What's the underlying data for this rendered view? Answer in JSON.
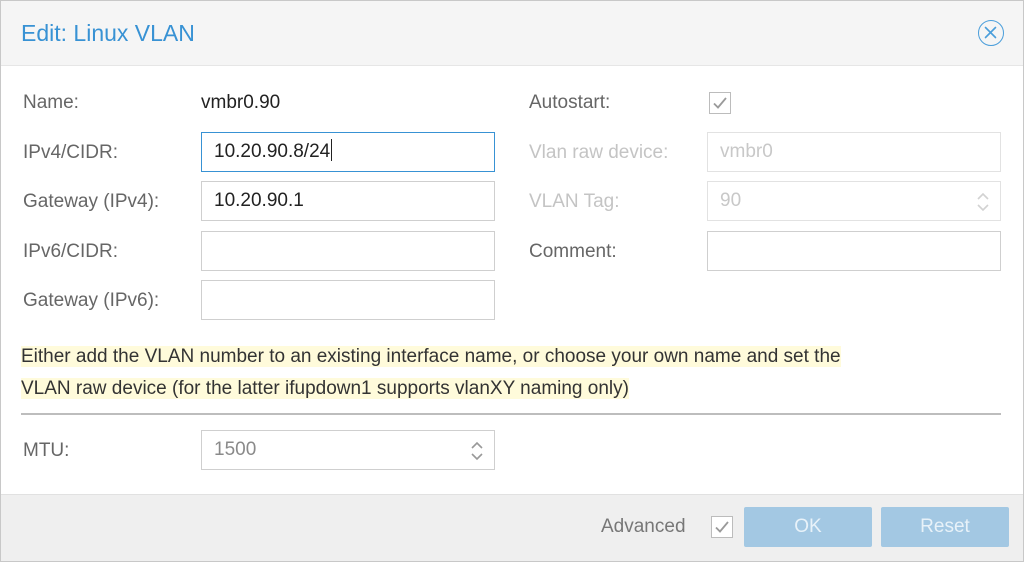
{
  "dialog": {
    "title": "Edit: Linux VLAN"
  },
  "form": {
    "name_label": "Name:",
    "name_value": "vmbr0.90",
    "ipv4_label": "IPv4/CIDR:",
    "ipv4_value": "10.20.90.8/24",
    "gateway4_label": "Gateway (IPv4):",
    "gateway4_value": "10.20.90.1",
    "ipv6_label": "IPv6/CIDR:",
    "ipv6_value": "",
    "gateway6_label": "Gateway (IPv6):",
    "gateway6_value": "",
    "autostart_label": "Autostart:",
    "autostart_checked": true,
    "raw_device_label": "Vlan raw device:",
    "raw_device_value": "vmbr0",
    "vlan_tag_label": "VLAN Tag:",
    "vlan_tag_value": "90",
    "comment_label": "Comment:",
    "comment_value": ""
  },
  "notice": {
    "line1": "Either add the VLAN number to an existing interface name, or choose your own name and set the",
    "line2": "VLAN raw device (for the latter ifupdown1 supports vlanXY naming only)"
  },
  "advanced": {
    "mtu_label": "MTU:",
    "mtu_value": "1500"
  },
  "footer": {
    "advanced_label": "Advanced",
    "advanced_checked": true,
    "ok_label": "OK",
    "reset_label": "Reset"
  },
  "colors": {
    "accent": "#3892d4",
    "button_disabled": "#a3c8e3",
    "notice_bg": "#fffbdb"
  },
  "icons": {
    "close": "close-circle-icon",
    "check": "check-icon",
    "spinner": "up-down-chevron-icon"
  }
}
